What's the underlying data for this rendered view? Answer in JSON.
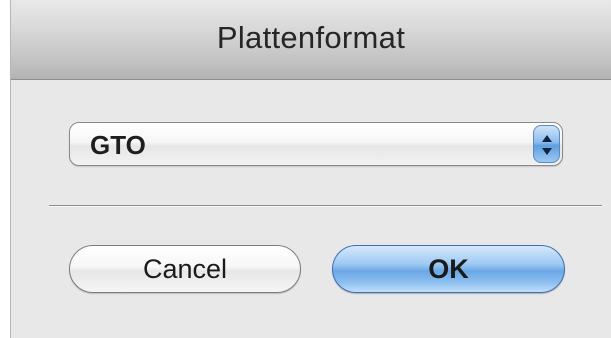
{
  "window": {
    "title": "Plattenformat"
  },
  "format_popup": {
    "selected_value": "GTO",
    "icon": "updown-arrows-icon"
  },
  "buttons": {
    "cancel_label": "Cancel",
    "ok_label": "OK"
  },
  "colors": {
    "default_button_accent": "#6aa7e6",
    "popup_arrow_accent": "#5f9fe0"
  }
}
